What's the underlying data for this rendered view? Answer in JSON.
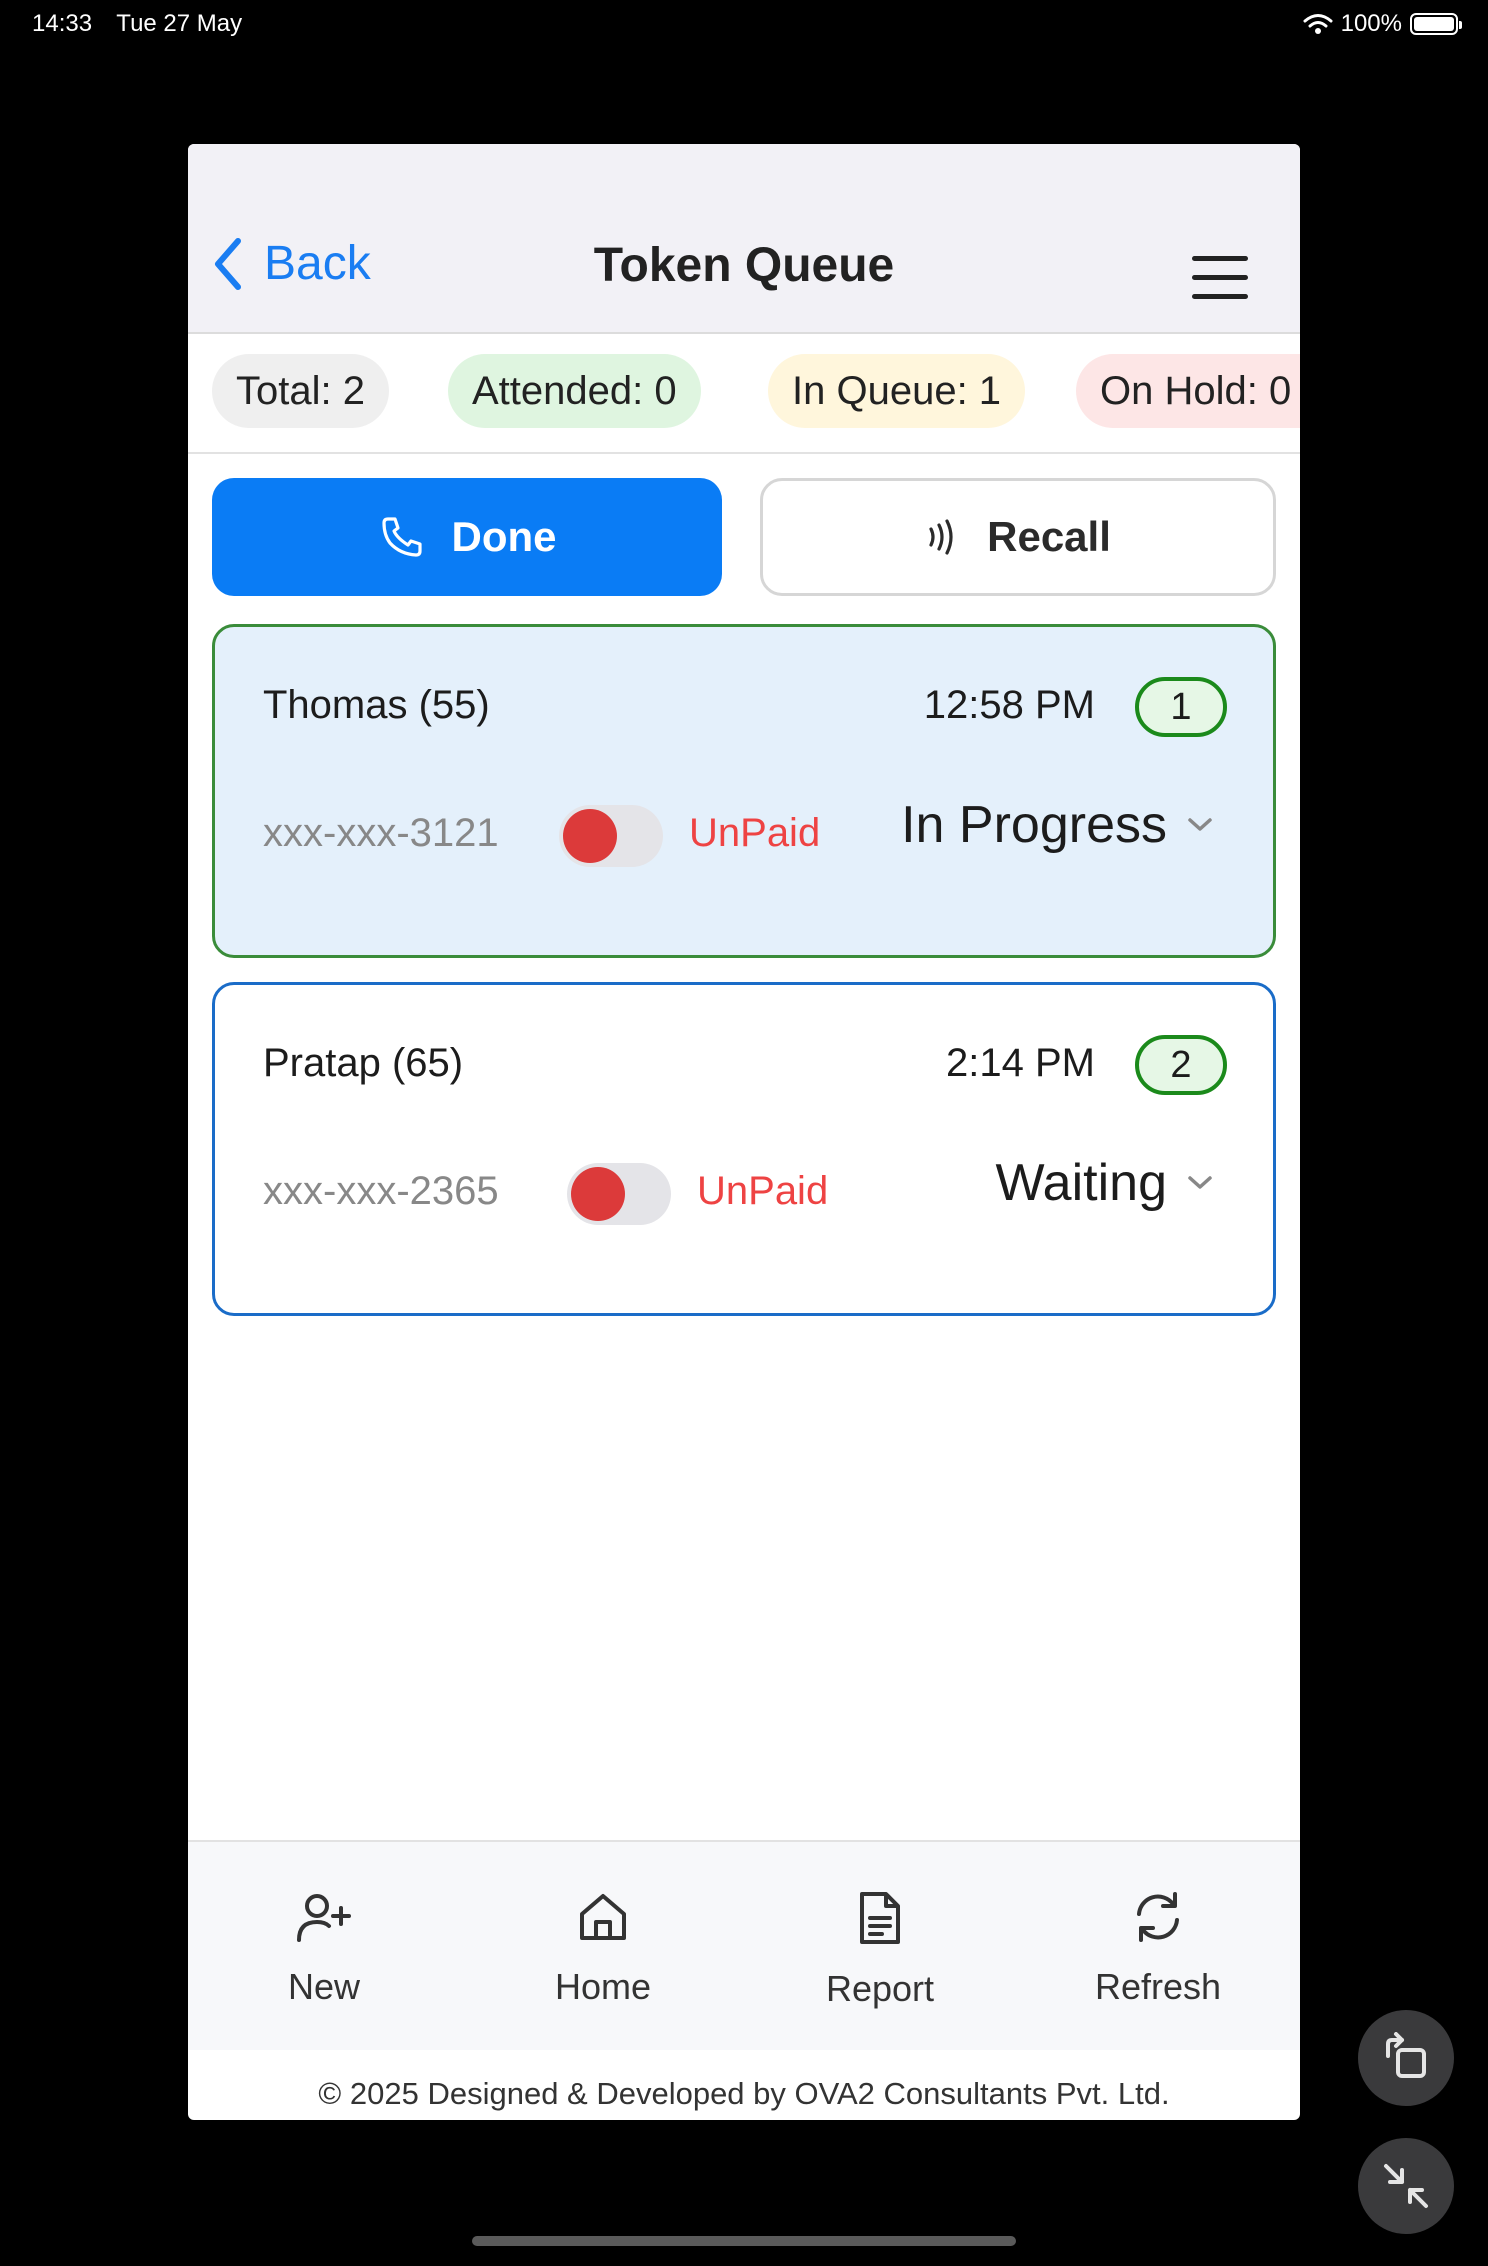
{
  "status_bar": {
    "time": "14:33",
    "date": "Tue 27 May",
    "battery": "100%"
  },
  "nav": {
    "back_label": "Back",
    "title": "Token Queue"
  },
  "stats": {
    "total": "Total: 2",
    "attended": "Attended: 0",
    "in_queue": "In Queue: 1",
    "on_hold": "On Hold: 0"
  },
  "actions": {
    "done_label": "Done",
    "recall_label": "Recall"
  },
  "tokens": [
    {
      "name": "Thomas (55)",
      "time": "12:58 PM",
      "token": "1",
      "phone": "xxx-xxx-3121",
      "payment": "UnPaid",
      "status": "In Progress"
    },
    {
      "name": "Pratap (65)",
      "time": "2:14 PM",
      "token": "2",
      "phone": "xxx-xxx-2365",
      "payment": "UnPaid",
      "status": "Waiting"
    }
  ],
  "tabs": [
    {
      "label": "New",
      "icon": "user-plus-icon"
    },
    {
      "label": "Home",
      "icon": "home-icon"
    },
    {
      "label": "Report",
      "icon": "document-icon"
    },
    {
      "label": "Refresh",
      "icon": "refresh-icon"
    }
  ],
  "footer": {
    "text": "© 2025 Designed & Developed by OVA2 Consultants Pvt. Ltd."
  },
  "colors": {
    "accent": "#0a7cf5",
    "unpaid": "#ee4343",
    "active_border": "#3a8c3a",
    "waiting_border": "#1a6cc8"
  }
}
